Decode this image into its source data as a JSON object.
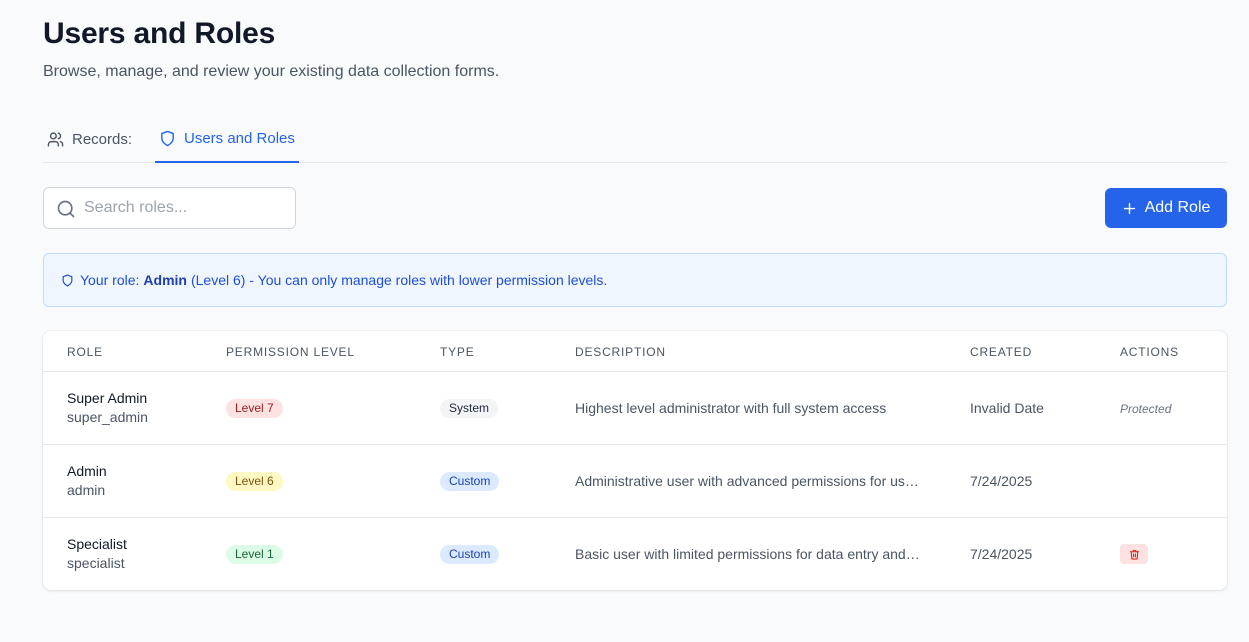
{
  "header": {
    "title": "Users and Roles",
    "subtitle": "Browse, manage, and review your existing data collection forms."
  },
  "tabs": [
    {
      "label": "Records:",
      "icon": "users-icon",
      "active": false
    },
    {
      "label": "Users and Roles",
      "icon": "shield-icon",
      "active": true
    }
  ],
  "search": {
    "placeholder": "Search roles...",
    "value": ""
  },
  "add_role_label": "Add Role",
  "notice": {
    "prefix": "Your role:",
    "role": "Admin",
    "suffix": "(Level 6) - You can only manage roles with lower permission levels."
  },
  "table": {
    "columns": [
      "ROLE",
      "PERMISSION LEVEL",
      "TYPE",
      "DESCRIPTION",
      "CREATED",
      "ACTIONS"
    ],
    "rows": [
      {
        "name": "Super Admin",
        "key": "super_admin",
        "level": "Level 7",
        "type": "System",
        "description": "Highest level administrator with full system access",
        "created": "Invalid Date",
        "action": "Protected"
      },
      {
        "name": "Admin",
        "key": "admin",
        "level": "Level 6",
        "type": "Custom",
        "description": "Administrative user with advanced permissions for user management",
        "created": "7/24/2025",
        "action": ""
      },
      {
        "name": "Specialist",
        "key": "specialist",
        "level": "Level 1",
        "type": "Custom",
        "description": "Basic user with limited permissions for data entry and viewing",
        "created": "7/24/2025",
        "action": "delete"
      }
    ]
  },
  "colors": {
    "accent": "#2563eb",
    "notice_bg": "#eff6ff",
    "danger_bg": "#fee2e2"
  }
}
